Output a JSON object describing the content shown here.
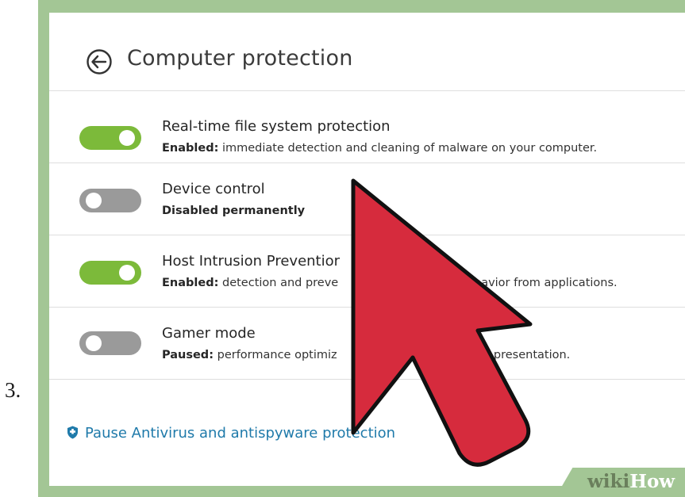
{
  "step": {
    "number": "3."
  },
  "header": {
    "title": "Computer protection",
    "back_icon": "back-arrow-circle-icon"
  },
  "settings": [
    {
      "title": "Real-time file system protection",
      "status_label": "Enabled:",
      "status_text": " immediate detection and cleaning of malware on your computer.",
      "state": "on"
    },
    {
      "title": "Device control",
      "status_label": "Disabled permanently",
      "status_text": "",
      "state": "off"
    },
    {
      "title": "Host Intrusion Preventior",
      "status_label": "Enabled:",
      "status_text": " detection and preve",
      "status_text_right": "havior from applications.",
      "state": "on"
    },
    {
      "title": "Gamer mode",
      "status_label": "Paused:",
      "status_text": " performance optimiz",
      "status_text_right": "and presentation.",
      "state": "off"
    }
  ],
  "footer": {
    "pause_link": "Pause Antivirus and antispyware protection",
    "pause_icon": "shield-icon"
  },
  "watermark": {
    "wiki": "wiki",
    "how": "How"
  },
  "colors": {
    "toggle_on": "#7cba3a",
    "toggle_off": "#9a9a9a",
    "frame": "#a3c695",
    "link": "#1f7aaa",
    "cursor_fill": "#d62b3d"
  }
}
